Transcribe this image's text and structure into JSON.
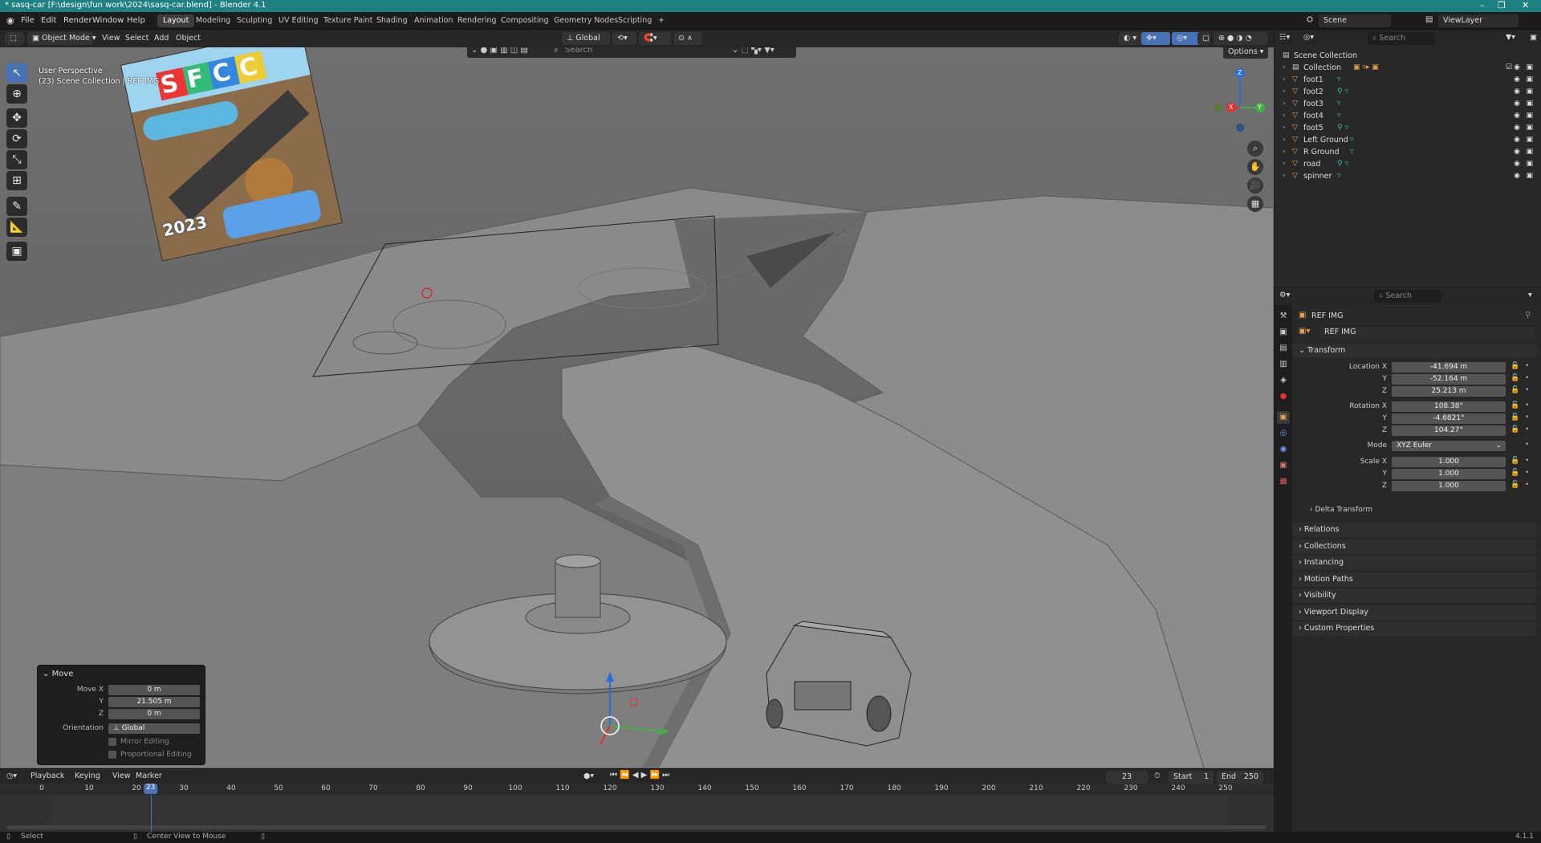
{
  "window": {
    "title": "* sasq-car [F:\\design\\fun work\\2024\\sasq-car.blend] - Blender 4.1",
    "controls": [
      "–",
      "❐",
      "✕"
    ]
  },
  "menus": [
    "File",
    "Edit",
    "Render",
    "Window",
    "Help"
  ],
  "workspaces": [
    "Layout",
    "Modeling",
    "Sculpting",
    "UV Editing",
    "Texture Paint",
    "Shading",
    "Animation",
    "Rendering",
    "Compositing",
    "Geometry Nodes",
    "Scripting",
    "+"
  ],
  "active_workspace": "Layout",
  "scene_name": "Scene",
  "view_layer": "ViewLayer",
  "viewport_header": {
    "mode": "Object Mode",
    "menus": [
      "View",
      "Select",
      "Add",
      "Object"
    ],
    "orientation": "Global",
    "search_placeholder": "Search",
    "options": "Options"
  },
  "viewport": {
    "info_line1": "User Perspective",
    "info_line2": "(23) Scene Collection | REF IMG",
    "ref_image_text": "SFCC",
    "ref_image_year": "2023"
  },
  "gizmo_axes": [
    "Z",
    "X",
    "Y"
  ],
  "move_panel": {
    "title": "Move",
    "move_x_label": "Move X",
    "move_x": "0 m",
    "y_label": "Y",
    "y": "21.505 m",
    "z_label": "Z",
    "z": "0 m",
    "orientation_label": "Orientation",
    "orientation": "Global",
    "mirror_editing": "Mirror Editing",
    "proportional_editing": "Proportional Editing"
  },
  "timeline": {
    "menus": [
      "Playback",
      "Keying",
      "View",
      "Marker"
    ],
    "current_frame": "23",
    "start_label": "Start",
    "start": "1",
    "end_label": "End",
    "end": "250",
    "ticks": [
      "0",
      "10",
      "20",
      "30",
      "40",
      "50",
      "60",
      "70",
      "80",
      "90",
      "100",
      "110",
      "120",
      "130",
      "140",
      "150",
      "160",
      "170",
      "180",
      "190",
      "200",
      "210",
      "220",
      "230",
      "240",
      "250"
    ]
  },
  "status_bar": {
    "select": "Select",
    "center_view": "Center View to Mouse",
    "version": "4.1.1"
  },
  "outliner": {
    "search_placeholder": "Search",
    "root": "Scene Collection",
    "collection": "Collection",
    "items": [
      "foot1",
      "foot2",
      "foot3",
      "foot4",
      "foot5",
      "Left Ground",
      "R Ground",
      "road",
      "spinner"
    ]
  },
  "properties": {
    "search_placeholder": "Search",
    "object_name": "REF IMG",
    "data_name": "REF IMG",
    "transform_title": "Transform",
    "location_x_label": "Location X",
    "location_x": "-41.694 m",
    "location_y": "-52.164 m",
    "location_z": "25.213 m",
    "rotation_x_label": "Rotation X",
    "rotation_x": "108.38°",
    "rotation_y": "-4.6821°",
    "rotation_z": "104.27°",
    "mode_label": "Mode",
    "mode": "XYZ Euler",
    "scale_x_label": "Scale X",
    "scale_x": "1.000",
    "scale_y": "1.000",
    "scale_z": "1.000",
    "y_label": "Y",
    "z_label": "Z",
    "delta_transform": "Delta Transform",
    "sections": [
      "Relations",
      "Collections",
      "Instancing",
      "Motion Paths",
      "Visibility",
      "Viewport Display",
      "Custom Properties"
    ]
  },
  "colors": {
    "titlebar": "#1e8080",
    "accent": "#4772b3",
    "object_icon": "#e8a050",
    "mesh_icon": "#35c0a0",
    "frame_indicator": "#4772b3"
  }
}
